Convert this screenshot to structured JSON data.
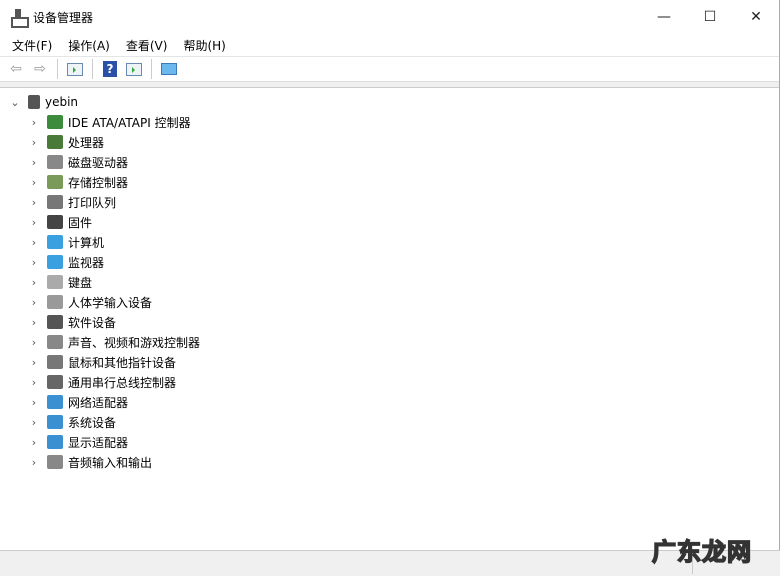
{
  "window": {
    "title": "设备管理器",
    "minimize": "—",
    "maximize": "☐",
    "close": "✕"
  },
  "menu": [
    "文件(F)",
    "操作(A)",
    "查看(V)",
    "帮助(H)"
  ],
  "toolbar": {
    "back": "⇦",
    "forward": "⇨",
    "help": "?"
  },
  "tree": {
    "root": "yebin",
    "items": [
      {
        "label": "IDE ATA/ATAPI 控制器",
        "color": "#3c8a3c"
      },
      {
        "label": "处理器",
        "color": "#4a7a3a"
      },
      {
        "label": "磁盘驱动器",
        "color": "#888888"
      },
      {
        "label": "存储控制器",
        "color": "#7a9a5a"
      },
      {
        "label": "打印队列",
        "color": "#777777"
      },
      {
        "label": "固件",
        "color": "#444444"
      },
      {
        "label": "计算机",
        "color": "#3aa0e0"
      },
      {
        "label": "监视器",
        "color": "#3aa0e0"
      },
      {
        "label": "键盘",
        "color": "#aaaaaa"
      },
      {
        "label": "人体学输入设备",
        "color": "#999999"
      },
      {
        "label": "软件设备",
        "color": "#555555"
      },
      {
        "label": "声音、视频和游戏控制器",
        "color": "#888888"
      },
      {
        "label": "鼠标和其他指针设备",
        "color": "#777777"
      },
      {
        "label": "通用串行总线控制器",
        "color": "#666666"
      },
      {
        "label": "网络适配器",
        "color": "#3a90d0"
      },
      {
        "label": "系统设备",
        "color": "#3a90d0"
      },
      {
        "label": "显示适配器",
        "color": "#3a90d0"
      },
      {
        "label": "音频输入和输出",
        "color": "#888888"
      }
    ]
  },
  "watermark": "广东龙网"
}
